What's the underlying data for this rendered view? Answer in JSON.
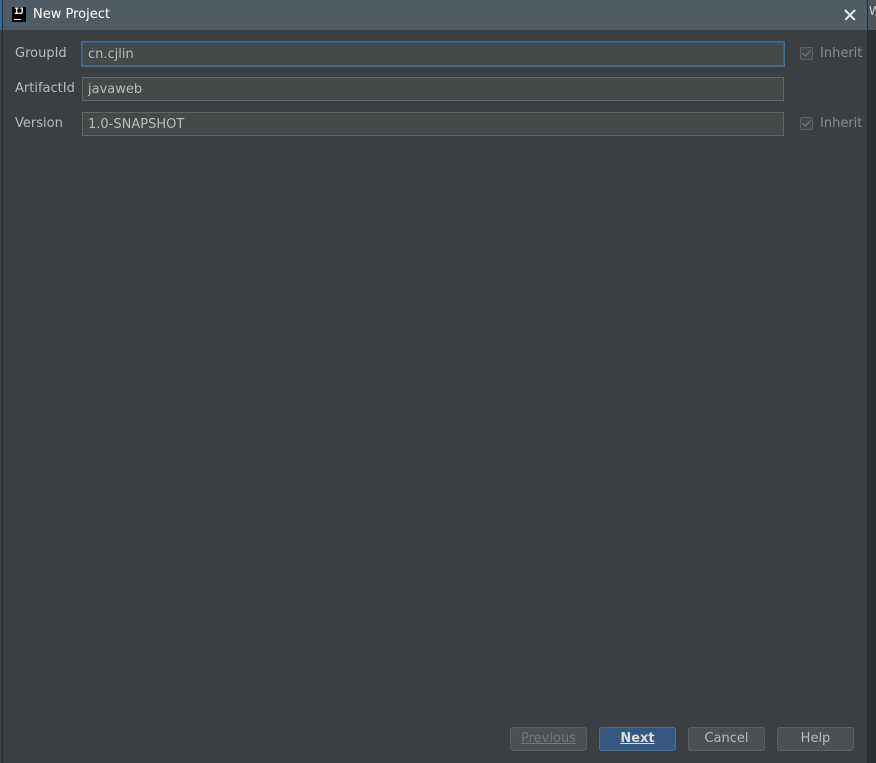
{
  "window": {
    "title": "New Project",
    "background_letter": "W"
  },
  "form": {
    "group_id": {
      "label": "GroupId",
      "value": "cn.cjlin",
      "inherit_label": "Inherit",
      "inherit_checked": true
    },
    "artifact_id": {
      "label": "ArtifactId",
      "value": "javaweb"
    },
    "version": {
      "label": "Version",
      "value": "1.0-SNAPSHOT",
      "inherit_label": "Inherit",
      "inherit_checked": true
    }
  },
  "buttons": {
    "previous": "Previous",
    "next": "Next",
    "cancel": "Cancel",
    "help": "Help"
  },
  "colors": {
    "dialog_bg": "#3c3f41",
    "titlebar_bg": "#4e5c66",
    "primary_button": "#365880",
    "focus_border": "#466d94"
  }
}
